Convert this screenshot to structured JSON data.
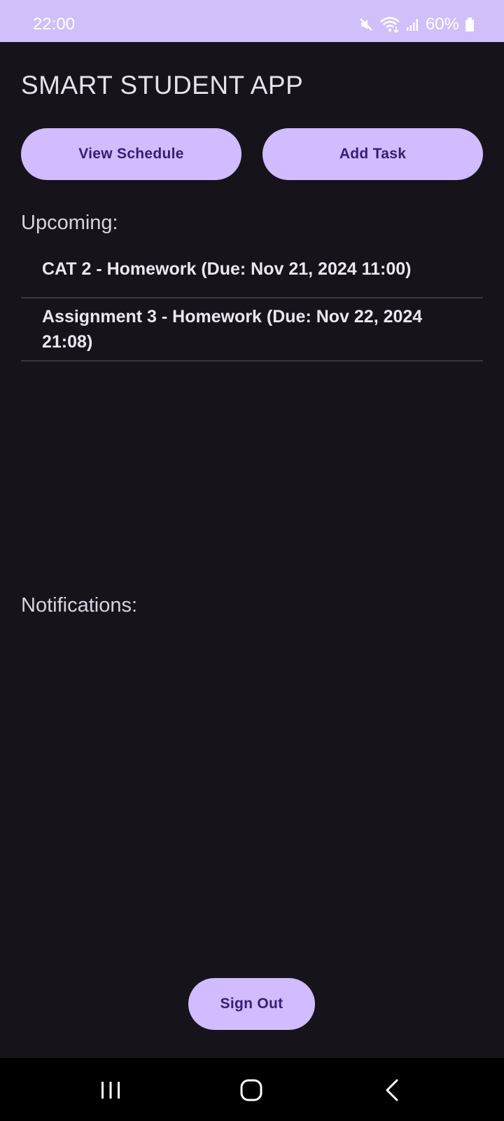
{
  "status_bar": {
    "time": "22:00",
    "battery": "60%",
    "icons": [
      "mute-icon",
      "wifi-icon",
      "signal-icon",
      "battery-icon"
    ],
    "background": "#d1bff9"
  },
  "app": {
    "title": "SMART STUDENT APP"
  },
  "actions": {
    "view_schedule_label": "View Schedule",
    "add_task_label": "Add Task",
    "sign_out_label": "Sign Out",
    "button_color": "#d0bcfe",
    "button_text_color": "#381e72"
  },
  "upcoming": {
    "label": "Upcoming:",
    "items": [
      {
        "text": "CAT 2 - Homework (Due: Nov 21, 2024 11:00)"
      },
      {
        "text": "Assignment 3 - Homework (Due: Nov 22, 2024 21:08)"
      }
    ]
  },
  "notifications": {
    "label": "Notifications:",
    "items": []
  },
  "nav_bar": {
    "icons": [
      "recent-apps-icon",
      "home-icon",
      "back-icon"
    ]
  }
}
